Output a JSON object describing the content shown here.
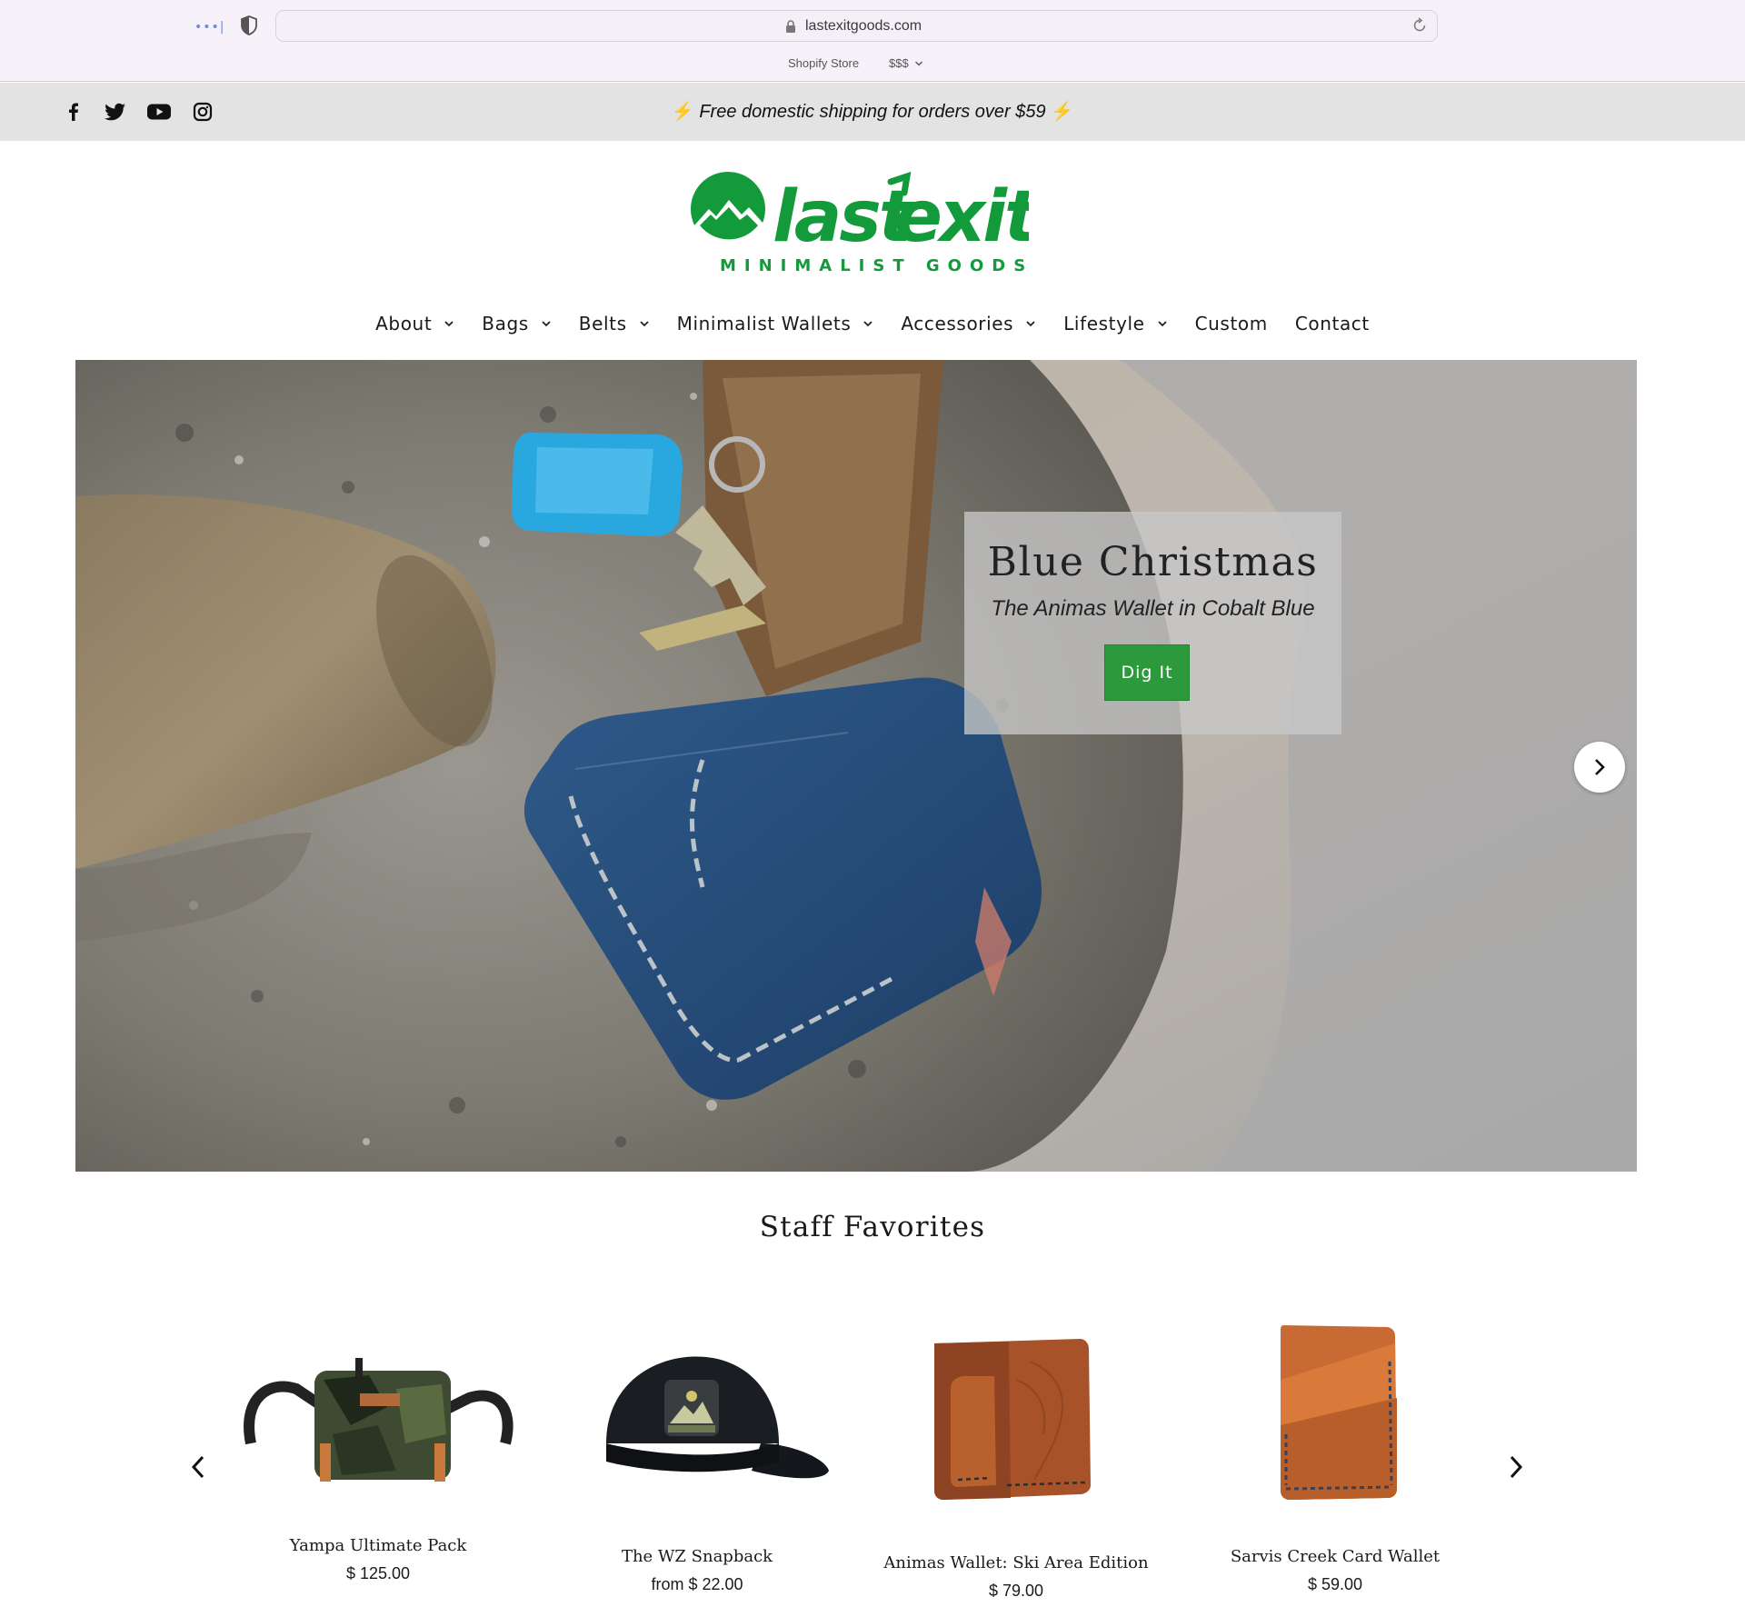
{
  "browser": {
    "url": "lastexitgoods.com",
    "extension_label": "Shopify Store",
    "price_label": "$$$",
    "icons": [
      "tab-overview-icon",
      "shield-icon",
      "lock-icon",
      "reload-icon",
      "chevron-down-icon"
    ]
  },
  "announcement": {
    "message": "Free domestic shipping for orders over $59",
    "bolt": "⚡",
    "social": [
      "facebook-icon",
      "twitter-icon",
      "youtube-icon",
      "instagram-icon"
    ]
  },
  "logo": {
    "wordmark": "last exit",
    "tagline": "MINIMALIST GOODS",
    "brand_color": "#139a3b"
  },
  "nav": {
    "items": [
      {
        "label": "About",
        "dropdown": true
      },
      {
        "label": "Bags",
        "dropdown": true
      },
      {
        "label": "Belts",
        "dropdown": true
      },
      {
        "label": "Minimalist Wallets",
        "dropdown": true
      },
      {
        "label": "Accessories",
        "dropdown": true
      },
      {
        "label": "Lifestyle",
        "dropdown": true
      },
      {
        "label": "Custom",
        "dropdown": false
      },
      {
        "label": "Contact",
        "dropdown": false
      }
    ]
  },
  "hero": {
    "title": "Blue Christmas",
    "subtitle": "The Animas Wallet in Cobalt Blue",
    "button_label": "Dig It",
    "button_color": "#2c9a3c"
  },
  "favorites": {
    "title": "Staff Favorites",
    "products": [
      {
        "name": "Yampa Ultimate Pack",
        "price": "$ 125.00"
      },
      {
        "name": "The WZ Snapback",
        "price": "from $ 22.00"
      },
      {
        "name": "Animas Wallet: Ski Area Edition",
        "price": "$ 79.00"
      },
      {
        "name": "Sarvis Creek Card Wallet",
        "price": "$ 59.00"
      }
    ]
  }
}
